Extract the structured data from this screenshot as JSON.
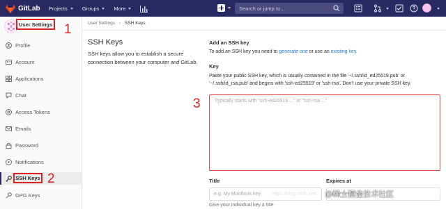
{
  "navbar": {
    "brand": "GitLab",
    "menu": [
      {
        "label": "Projects"
      },
      {
        "label": "Groups"
      },
      {
        "label": "More"
      }
    ],
    "search_placeholder": "Search or jump to...",
    "bg_color": "#292961"
  },
  "sidebar": {
    "title": "User Settings",
    "items": [
      {
        "label": "Profile",
        "icon": "profile-icon"
      },
      {
        "label": "Account",
        "icon": "account-icon"
      },
      {
        "label": "Applications",
        "icon": "applications-icon"
      },
      {
        "label": "Chat",
        "icon": "chat-icon"
      },
      {
        "label": "Access Tokens",
        "icon": "access-tokens-icon"
      },
      {
        "label": "Emails",
        "icon": "emails-icon"
      },
      {
        "label": "Password",
        "icon": "password-icon"
      },
      {
        "label": "Notifications",
        "icon": "notifications-icon"
      },
      {
        "label": "SSH Keys",
        "icon": "key-icon",
        "active": true
      },
      {
        "label": "GPG Keys",
        "icon": "gpg-key-icon"
      }
    ]
  },
  "annotations": {
    "n1": "1",
    "n2": "2",
    "n3": "3",
    "color": "#e02020"
  },
  "breadcrumb": {
    "parent": "User Settings",
    "current": "SSH Keys"
  },
  "left": {
    "title": "SSH Keys",
    "description": "SSH keys allow you to establish a secure connection between your computer and GitLab."
  },
  "form": {
    "heading": "Add an SSH key",
    "intro_prefix": "To add an SSH key you need to ",
    "intro_link1": "generate one",
    "intro_mid": " or use an ",
    "intro_link2": "existing key",
    "intro_suffix": ".",
    "key_label": "Key",
    "key_help": "Paste your public SSH key, which is usually contained in the file '~/.ssh/id_ed25519.pub' or '~/.ssh/id_rsa.pub' and begins with 'ssh-ed25519' or 'ssh-rsa'. Don't use your private SSH key.",
    "key_placeholder": "Typically starts with \"ssh-ed25519 ...\" or \"ssh-rsa ...\"",
    "title_label": "Title",
    "title_placeholder": "e.g. My MacBook key",
    "title_help": "Give your individual key a title",
    "expires_label": "Expires at",
    "expires_placeholder": "yyyy / mm / dd",
    "link_color": "#1f78d1"
  },
  "watermark": {
    "text": "@稀土掘金技术社区",
    "url": "https://blog.csdn.net/..."
  }
}
